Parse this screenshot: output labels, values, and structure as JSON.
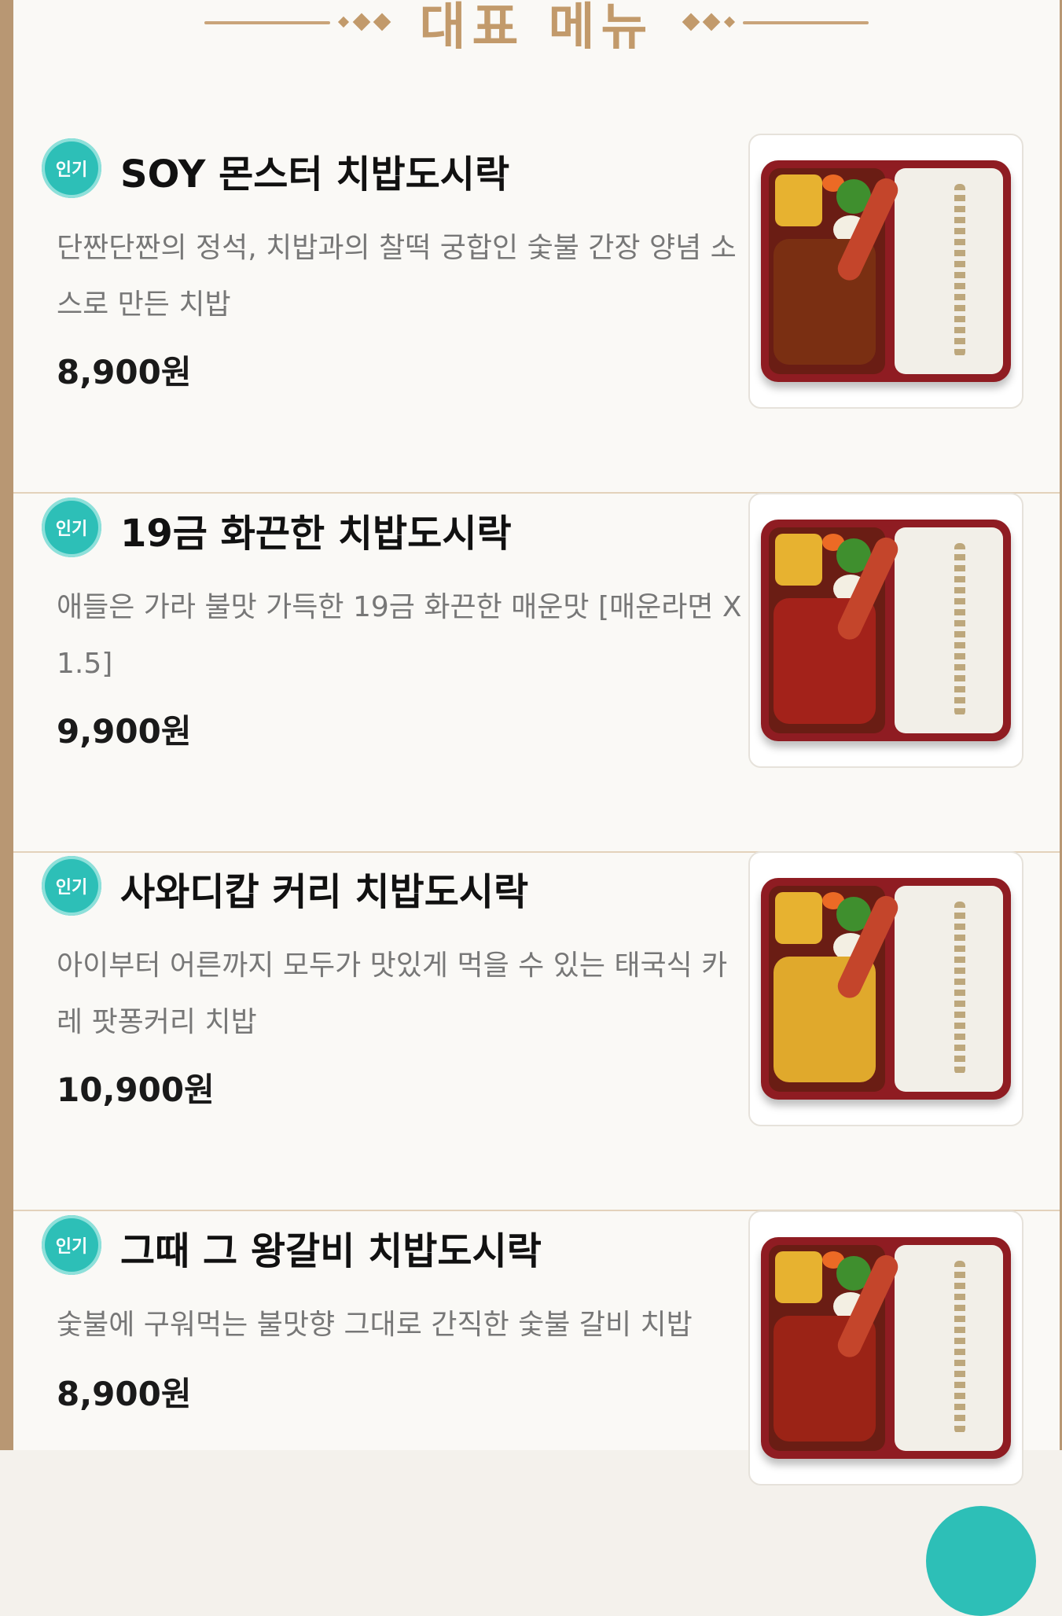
{
  "header": {
    "title": "대표 메뉴"
  },
  "items": [
    {
      "badge": "인기",
      "name": "SOY 몬스터 치밥도시락",
      "desc": "단짠단짠의 정석, 치밥과의 찰떡 궁합인 숯불 간장 양념 소스로 만든 치밥",
      "price": "8,900원",
      "main_color": "#7a2f12"
    },
    {
      "badge": "인기",
      "name": "19금 화끈한 치밥도시락",
      "desc": "애들은 가라 불맛 가득한 19금 화끈한 매운맛 [매운라면 X 1.5]",
      "price": "9,900원",
      "main_color": "#a3221a"
    },
    {
      "badge": "인기",
      "name": "사와디캅 커리 치밥도시락",
      "desc": "아이부터 어른까지 모두가 맛있게 먹을 수 있는 태국식 카레 팟퐁커리 치밥",
      "price": "10,900원",
      "main_color": "#e0a92c"
    },
    {
      "badge": "인기",
      "name": "그때 그 왕갈비 치밥도시락",
      "desc": "숯불에 구워먹는 불맛향 그대로 간직한 숯불 갈비 치밥",
      "price": "8,900원",
      "main_color": "#9b2316"
    }
  ]
}
